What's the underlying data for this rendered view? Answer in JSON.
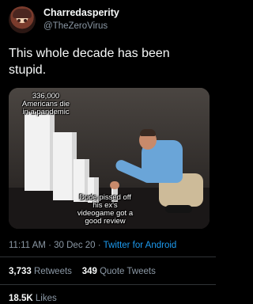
{
  "user": {
    "name": "Charredasperity",
    "handle": "@TheZeroVirus",
    "avatar_icon": "anime-avatar"
  },
  "tweet": {
    "text": "This whole decade has been stupid."
  },
  "media": {
    "caption_top": "336,000 Americans die in a pandemic",
    "caption_bottom": "Dude pissed off his ex's videogame got a good review"
  },
  "meta": {
    "time": "11:11 AM",
    "separator": "·",
    "date": "30 Dec 20",
    "separator2": "·",
    "app": "Twitter for Android"
  },
  "stats": {
    "retweets_count": "3,733",
    "retweets_label": "Retweets",
    "quotes_count": "349",
    "quotes_label": "Quote Tweets",
    "likes_count": "18.5K",
    "likes_label": "Likes"
  },
  "colors": {
    "background": "#000000",
    "text": "#f7f9f9",
    "secondary": "#8b98a5",
    "link": "#1d9bf0"
  }
}
